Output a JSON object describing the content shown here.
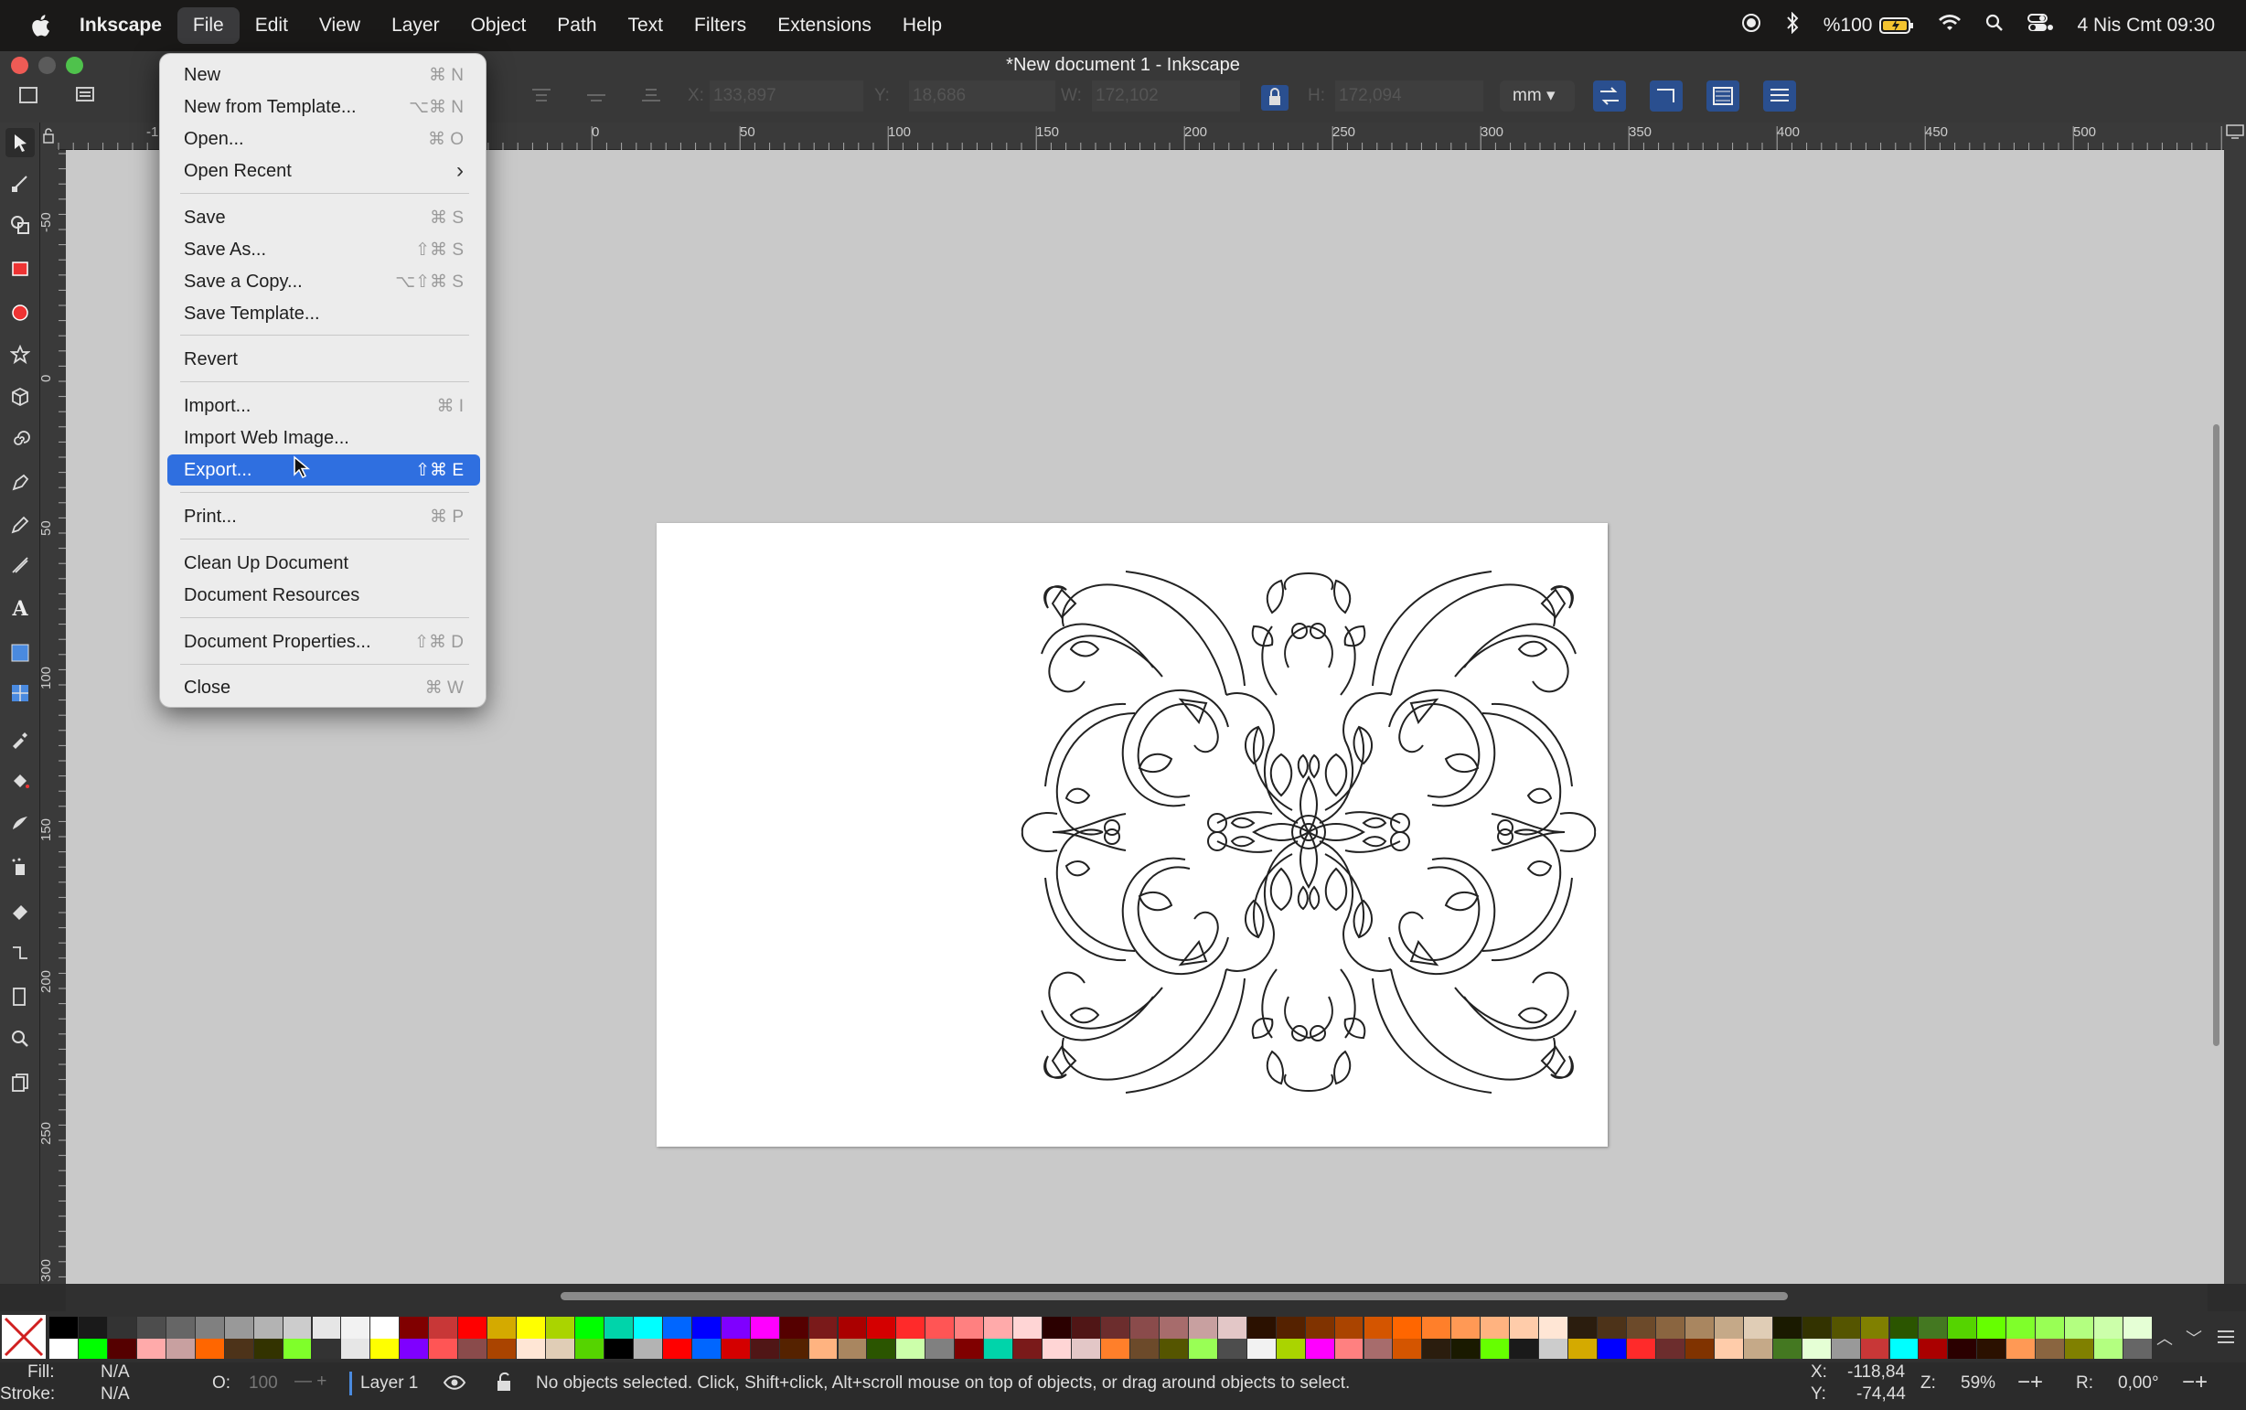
{
  "menubar": {
    "app_name": "Inkscape",
    "menus": [
      "File",
      "Edit",
      "View",
      "Layer",
      "Object",
      "Path",
      "Text",
      "Filters",
      "Extensions",
      "Help"
    ],
    "battery": "%100",
    "datetime": "4 Nis Cmt  09:30"
  },
  "window": {
    "title": "*New document 1 - Inkscape"
  },
  "toolbar": {
    "x_label": "X:",
    "x_value": "133,897",
    "y_label": "Y:",
    "y_value": "18,686",
    "w_label": "W:",
    "w_value": "172,102",
    "h_label": "H:",
    "h_value": "172,094",
    "unit": "mm"
  },
  "ruler": {
    "top_ticks": [
      "-1",
      "0",
      "50",
      "100",
      "150",
      "200",
      "250",
      "300",
      "350",
      "400",
      "450",
      "500"
    ],
    "left_ticks": [
      "-50",
      "0",
      "50",
      "100",
      "150",
      "200",
      "250",
      "300"
    ]
  },
  "file_menu": {
    "items": [
      {
        "label": "New",
        "shortcut": "⌘ N"
      },
      {
        "label": "New from Template...",
        "shortcut": "⌥⌘ N"
      },
      {
        "label": "Open...",
        "shortcut": "⌘ O"
      },
      {
        "label": "Open Recent",
        "shortcut": "›"
      },
      {
        "label": "Save",
        "shortcut": "⌘ S"
      },
      {
        "label": "Save As...",
        "shortcut": "⇧⌘ S"
      },
      {
        "label": "Save a Copy...",
        "shortcut": "⌥⇧⌘ S"
      },
      {
        "label": "Save Template...",
        "shortcut": ""
      },
      {
        "label": "Revert",
        "shortcut": ""
      },
      {
        "label": "Import...",
        "shortcut": "⌘ I"
      },
      {
        "label": "Import Web Image...",
        "shortcut": ""
      },
      {
        "label": "Export...",
        "shortcut": "⇧⌘ E"
      },
      {
        "label": "Print...",
        "shortcut": "⌘ P"
      },
      {
        "label": "Clean Up Document",
        "shortcut": ""
      },
      {
        "label": "Document Resources",
        "shortcut": ""
      },
      {
        "label": "Document Properties...",
        "shortcut": "⇧⌘ D"
      },
      {
        "label": "Close",
        "shortcut": "⌘ W"
      }
    ],
    "highlighted": "Export..."
  },
  "status": {
    "fill_label": "Fill:",
    "fill_value": "N/A",
    "stroke_label": "Stroke:",
    "stroke_value": "N/A",
    "opacity_label": "O:",
    "opacity_value": "100",
    "layer": "Layer 1",
    "message": "No objects selected. Click, Shift+click, Alt+scroll mouse on top of objects, or drag around objects to select.",
    "cursor_x_label": "X:",
    "cursor_x": "-118,84",
    "cursor_y_label": "Y:",
    "cursor_y": "-74,44",
    "zoom_label": "Z:",
    "zoom": "59%",
    "rotation_label": "R:",
    "rotation": "0,00°"
  },
  "palette_colors": [
    "#000000",
    "#1a1a1a",
    "#333333",
    "#4d4d4d",
    "#666666",
    "#808080",
    "#999999",
    "#b3b3b3",
    "#cccccc",
    "#e6e6e6",
    "#f2f2f2",
    "#ffffff",
    "#800000",
    "#c83737",
    "#ff0000",
    "#d4aa00",
    "#ffff00",
    "#aad400",
    "#00ff00",
    "#00d4aa",
    "#00ffff",
    "#0066ff",
    "#0000ff",
    "#7f00ff",
    "#ff00ff",
    "#550000",
    "#7a1a1a",
    "#aa0000",
    "#d40000",
    "#ff2a2a",
    "#ff5555",
    "#ff8080",
    "#ffaaaa",
    "#ffd5d5",
    "#2b0000",
    "#501616",
    "#6c2d2d",
    "#8a4b4b",
    "#a76c6c",
    "#c8a0a0",
    "#e3c7c7",
    "#2b1100",
    "#552200",
    "#803300",
    "#aa4400",
    "#d45500",
    "#ff6600",
    "#ff7f2a",
    "#ff9955",
    "#ffb380",
    "#ffccaa",
    "#ffe6d5",
    "#2b1d0e",
    "#4d3319",
    "#6c4a2a",
    "#8a6540",
    "#a98660",
    "#c5a988",
    "#e0cdb6",
    "#1a1a00",
    "#333300",
    "#555500",
    "#808000",
    "#2b5500",
    "#447821",
    "#55d400",
    "#66ff00",
    "#7fff2a",
    "#99ff55",
    "#b3ff80",
    "#ccffaa",
    "#e5ffd5"
  ]
}
